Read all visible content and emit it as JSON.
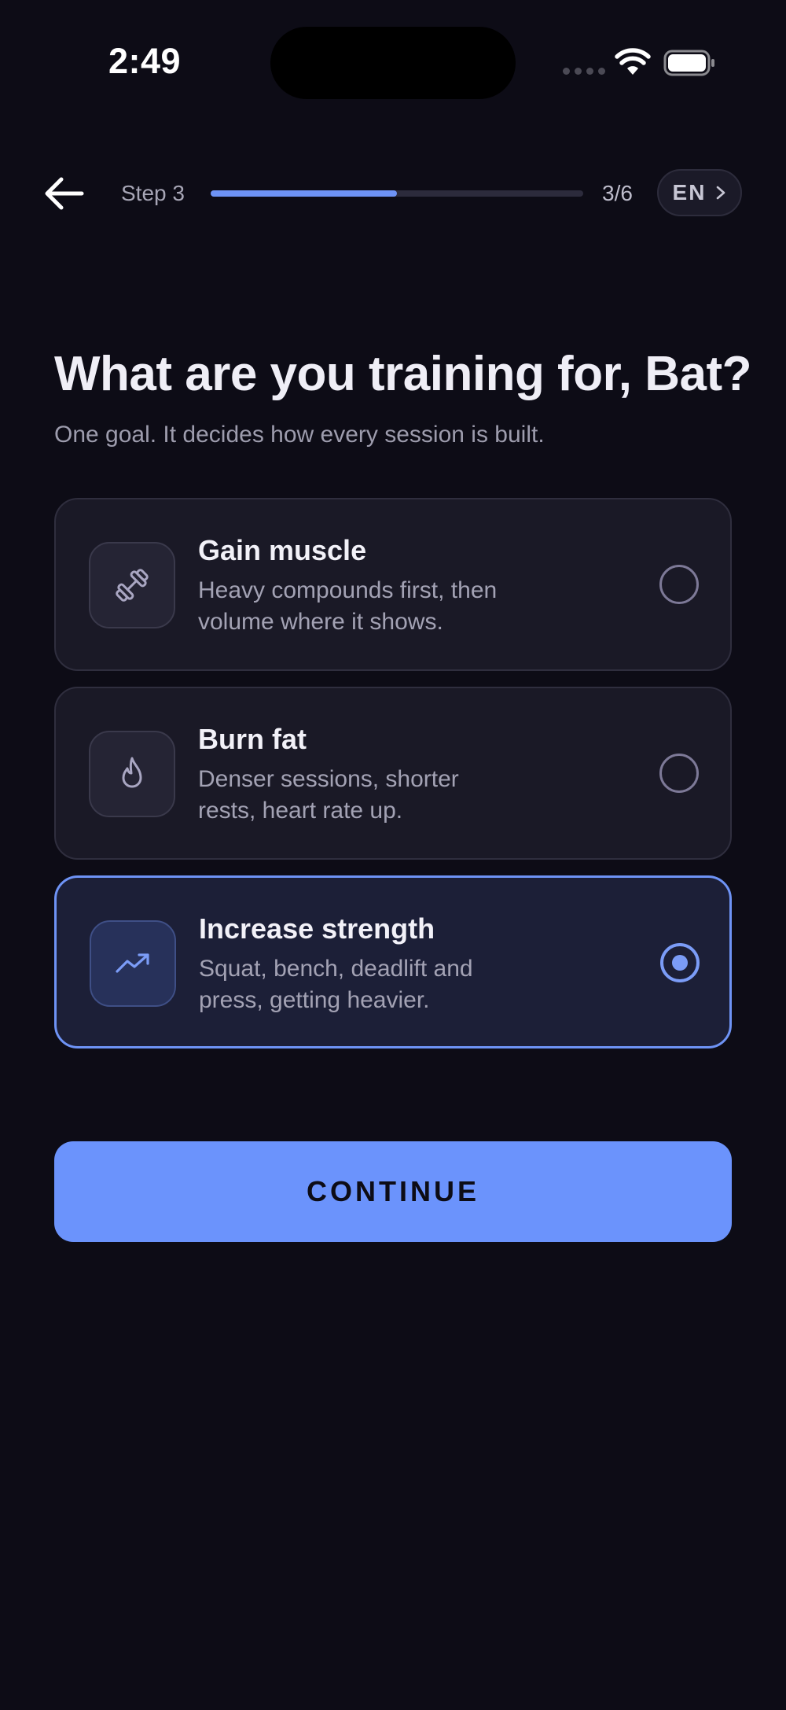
{
  "status_bar": {
    "time": "2:49"
  },
  "header": {
    "back_icon": "arrow-left-icon",
    "step_label": "Step 3",
    "progress": 0.5,
    "step_count": "3/6",
    "language": "EN"
  },
  "heading": {
    "title": "What are you training for, Bat?",
    "subtitle": "One goal. It decides how every session is built."
  },
  "options": [
    {
      "icon": "dumbbell-icon",
      "title": "Gain muscle",
      "description": "Heavy compounds first, then volume where it shows.",
      "selected": false
    },
    {
      "icon": "flame-icon",
      "title": "Burn fat",
      "description": "Denser sessions, shorter rests, heart rate up.",
      "selected": false
    },
    {
      "icon": "trending-up-icon",
      "title": "Increase strength",
      "description": "Squat, bench, deadlift and press, getting heavier.",
      "selected": true
    }
  ],
  "continue_label": "CONTINUE",
  "colors": {
    "background": "#0d0c16",
    "accent": "#6b93fc",
    "card": "#1a1926",
    "selected_card": "#1c1f37"
  }
}
